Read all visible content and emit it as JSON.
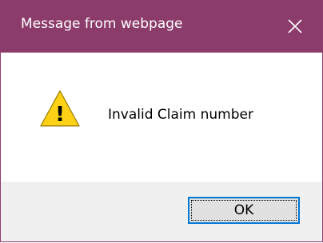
{
  "window": {
    "title": "Message from webpage",
    "close_icon": "close-icon",
    "titlebar_color": "#8c3c6b"
  },
  "content": {
    "icon": "warning-icon",
    "icon_glyph": "!",
    "message": "Invalid Claim number"
  },
  "footer": {
    "ok_label": "OK",
    "focus_color": "#0078d7"
  }
}
